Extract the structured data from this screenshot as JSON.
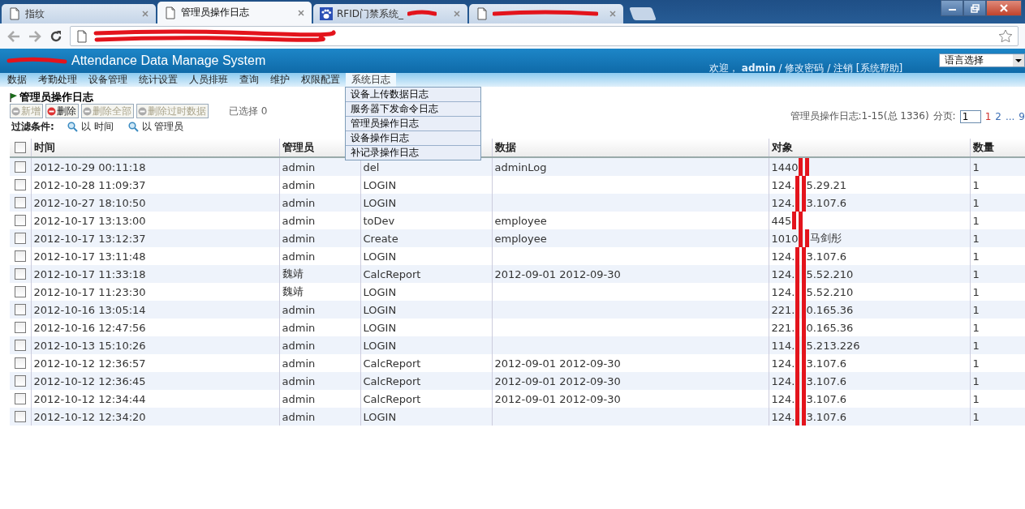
{
  "browser": {
    "tabs": [
      {
        "title": "指纹",
        "selected": false,
        "redacted": false
      },
      {
        "title": "管理员操作日志",
        "selected": true,
        "redacted": false
      },
      {
        "title": "RFID门禁系统_",
        "selected": false,
        "redacted": true
      },
      {
        "selected": false,
        "redacted": true
      }
    ],
    "address_bar": {
      "redacted": true
    }
  },
  "app": {
    "title": "Attendance Data Manage System",
    "title_redacted": true,
    "user_bar": "欢迎， **admin** / 修改密码 / 注销 [系统帮助]",
    "language_select": {
      "value": "语言选择"
    }
  },
  "nav": {
    "items": [
      {
        "label": "数据",
        "selected": false
      },
      {
        "label": "考勤处理",
        "selected": false
      },
      {
        "label": "设备管理",
        "selected": false
      },
      {
        "label": "统计设置",
        "selected": false
      },
      {
        "label": "人员排班",
        "selected": false
      },
      {
        "label": "查询",
        "selected": false
      },
      {
        "label": "维护",
        "selected": false
      },
      {
        "label": "权限配置",
        "selected": false
      },
      {
        "label": "系统日志",
        "selected": true
      }
    ],
    "submenu": [
      "设备上传数据日志",
      "服务器下发命令日志",
      "管理员操作日志",
      "设备操作日志",
      "补记录操作日志"
    ]
  },
  "page": {
    "title": "管理员操作日志",
    "buttons": [
      {
        "label": "新增",
        "kind": "add",
        "disabled": true
      },
      {
        "label": "删除",
        "kind": "delete",
        "disabled": false
      },
      {
        "label": "删除全部",
        "kind": "delete",
        "disabled": true
      },
      {
        "label": "删除过时数据",
        "kind": "delete",
        "disabled": true
      }
    ],
    "selected_count": "已选择 0",
    "filter_label": "过滤条件:",
    "filters": [
      "以 时间",
      "以 管理员"
    ],
    "summary": "管理员操作日志:1-15(总 1336)",
    "page_label": "分页:",
    "page_input": "1",
    "pages": [
      {
        "label": "1",
        "selected": true
      },
      {
        "label": "2",
        "selected": false
      },
      {
        "label": "...",
        "selected": false
      },
      {
        "label": "9",
        "selected": false
      }
    ]
  },
  "table": {
    "all_checked": false,
    "columns": [
      "时间",
      "管理员",
      null,
      "数据",
      "对象",
      "数量"
    ],
    "rows": [
      {
        "checked": false,
        "time": "2012-10-29 00:11:18",
        "admin": "admin",
        "action": "del",
        "data": "adminLog",
        "object": "1440",
        "count": "1"
      },
      {
        "checked": false,
        "time": "2012-10-28 11:09:37",
        "admin": "admin",
        "action": "LOGIN",
        "object": "124.",
        "object_rest": "5.29.21",
        "count": "1"
      },
      {
        "checked": false,
        "time": "2012-10-27 18:10:50",
        "admin": "admin",
        "action": "LOGIN",
        "object": "124.",
        "object_rest": "3.107.6",
        "count": "1"
      },
      {
        "checked": false,
        "time": "2012-10-17 13:13:00",
        "admin": "admin",
        "action": "toDev",
        "data": "employee",
        "object": "445",
        "count": "1"
      },
      {
        "checked": false,
        "time": "2012-10-17 13:12:37",
        "admin": "admin",
        "action": "Create",
        "data": "employee",
        "object": "1010",
        "object_rest": "马剑彤",
        "count": "1"
      },
      {
        "checked": false,
        "time": "2012-10-17 13:11:48",
        "admin": "admin",
        "action": "LOGIN",
        "object": "124.",
        "object_rest": "3.107.6",
        "count": "1"
      },
      {
        "checked": false,
        "time": "2012-10-17 11:33:18",
        "admin": "魏靖",
        "action": "CalcReport",
        "data": "2012-09-01 2012-09-30",
        "object": "124.",
        "object_rest": "5.52.210",
        "count": "1"
      },
      {
        "checked": false,
        "time": "2012-10-17 11:23:30",
        "admin": "魏靖",
        "action": "LOGIN",
        "object": "124.",
        "object_rest": "5.52.210",
        "count": "1"
      },
      {
        "checked": false,
        "time": "2012-10-16 13:05:14",
        "admin": "admin",
        "action": "LOGIN",
        "object": "221.",
        "object_rest": "0.165.36",
        "count": "1"
      },
      {
        "checked": false,
        "time": "2012-10-16 12:47:56",
        "admin": "admin",
        "action": "LOGIN",
        "object": "221.",
        "object_rest": "0.165.36",
        "count": "1"
      },
      {
        "checked": false,
        "time": "2012-10-13 15:10:26",
        "admin": "admin",
        "action": "LOGIN",
        "object": "114.",
        "object_rest": "5.213.226",
        "count": "1"
      },
      {
        "checked": false,
        "time": "2012-10-12 12:36:57",
        "admin": "admin",
        "action": "CalcReport",
        "data": "2012-09-01 2012-09-30",
        "object": "124.",
        "object_rest": "3.107.6",
        "count": "1"
      },
      {
        "checked": false,
        "time": "2012-10-12 12:36:45",
        "admin": "admin",
        "action": "CalcReport",
        "data": "2012-09-01 2012-09-30",
        "object": "124.",
        "object_rest": "3.107.6",
        "count": "1"
      },
      {
        "checked": false,
        "time": "2012-10-12 12:34:44",
        "admin": "admin",
        "action": "CalcReport",
        "data": "2012-09-01 2012-09-30",
        "object": "124.",
        "object_rest": "3.107.6",
        "count": "1"
      },
      {
        "checked": false,
        "time": "2012-10-12 12:34:20",
        "admin": "admin",
        "action": "LOGIN",
        "object": "124.",
        "object_rest": "3.107.6",
        "count": "1"
      }
    ]
  }
}
